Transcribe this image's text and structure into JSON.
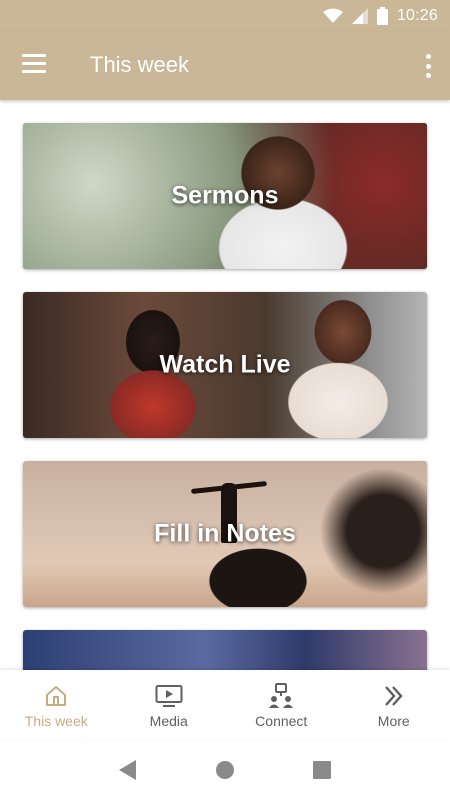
{
  "status_bar": {
    "time": "10:26"
  },
  "app_bar": {
    "title": "This week"
  },
  "cards": [
    {
      "label": "Sermons"
    },
    {
      "label": "Watch Live"
    },
    {
      "label": "Fill in Notes"
    },
    {
      "label": ""
    }
  ],
  "bottom_nav": [
    {
      "label": "This week",
      "icon": "home-icon",
      "active": true
    },
    {
      "label": "Media",
      "icon": "media-icon",
      "active": false
    },
    {
      "label": "Connect",
      "icon": "connect-icon",
      "active": false
    },
    {
      "label": "More",
      "icon": "more-chevrons-icon",
      "active": false
    }
  ],
  "colors": {
    "accent": "#cab797",
    "active_nav": "#c4ad86",
    "inactive_nav": "#5f5f5f"
  }
}
